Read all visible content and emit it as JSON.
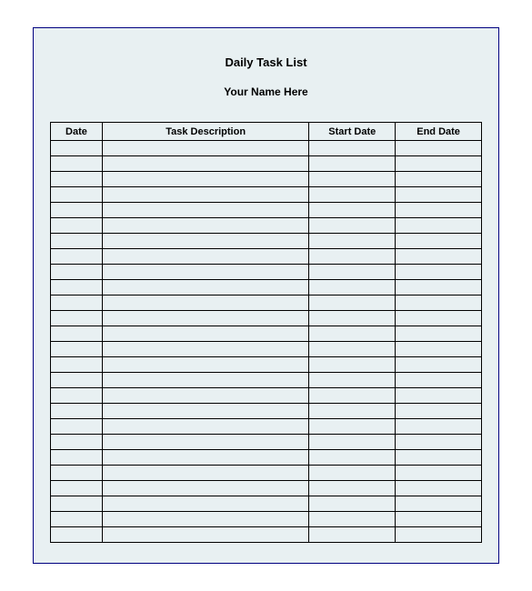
{
  "title": "Daily Task List",
  "subtitle": "Your Name Here",
  "columns": {
    "date": "Date",
    "description": "Task Description",
    "start_date": "Start Date",
    "end_date": "End Date"
  },
  "rows": [
    {
      "date": "",
      "description": "",
      "start_date": "",
      "end_date": ""
    },
    {
      "date": "",
      "description": "",
      "start_date": "",
      "end_date": ""
    },
    {
      "date": "",
      "description": "",
      "start_date": "",
      "end_date": ""
    },
    {
      "date": "",
      "description": "",
      "start_date": "",
      "end_date": ""
    },
    {
      "date": "",
      "description": "",
      "start_date": "",
      "end_date": ""
    },
    {
      "date": "",
      "description": "",
      "start_date": "",
      "end_date": ""
    },
    {
      "date": "",
      "description": "",
      "start_date": "",
      "end_date": ""
    },
    {
      "date": "",
      "description": "",
      "start_date": "",
      "end_date": ""
    },
    {
      "date": "",
      "description": "",
      "start_date": "",
      "end_date": ""
    },
    {
      "date": "",
      "description": "",
      "start_date": "",
      "end_date": ""
    },
    {
      "date": "",
      "description": "",
      "start_date": "",
      "end_date": ""
    },
    {
      "date": "",
      "description": "",
      "start_date": "",
      "end_date": ""
    },
    {
      "date": "",
      "description": "",
      "start_date": "",
      "end_date": ""
    },
    {
      "date": "",
      "description": "",
      "start_date": "",
      "end_date": ""
    },
    {
      "date": "",
      "description": "",
      "start_date": "",
      "end_date": ""
    },
    {
      "date": "",
      "description": "",
      "start_date": "",
      "end_date": ""
    },
    {
      "date": "",
      "description": "",
      "start_date": "",
      "end_date": ""
    },
    {
      "date": "",
      "description": "",
      "start_date": "",
      "end_date": ""
    },
    {
      "date": "",
      "description": "",
      "start_date": "",
      "end_date": ""
    },
    {
      "date": "",
      "description": "",
      "start_date": "",
      "end_date": ""
    },
    {
      "date": "",
      "description": "",
      "start_date": "",
      "end_date": ""
    },
    {
      "date": "",
      "description": "",
      "start_date": "",
      "end_date": ""
    },
    {
      "date": "",
      "description": "",
      "start_date": "",
      "end_date": ""
    },
    {
      "date": "",
      "description": "",
      "start_date": "",
      "end_date": ""
    },
    {
      "date": "",
      "description": "",
      "start_date": "",
      "end_date": ""
    },
    {
      "date": "",
      "description": "",
      "start_date": "",
      "end_date": ""
    }
  ]
}
